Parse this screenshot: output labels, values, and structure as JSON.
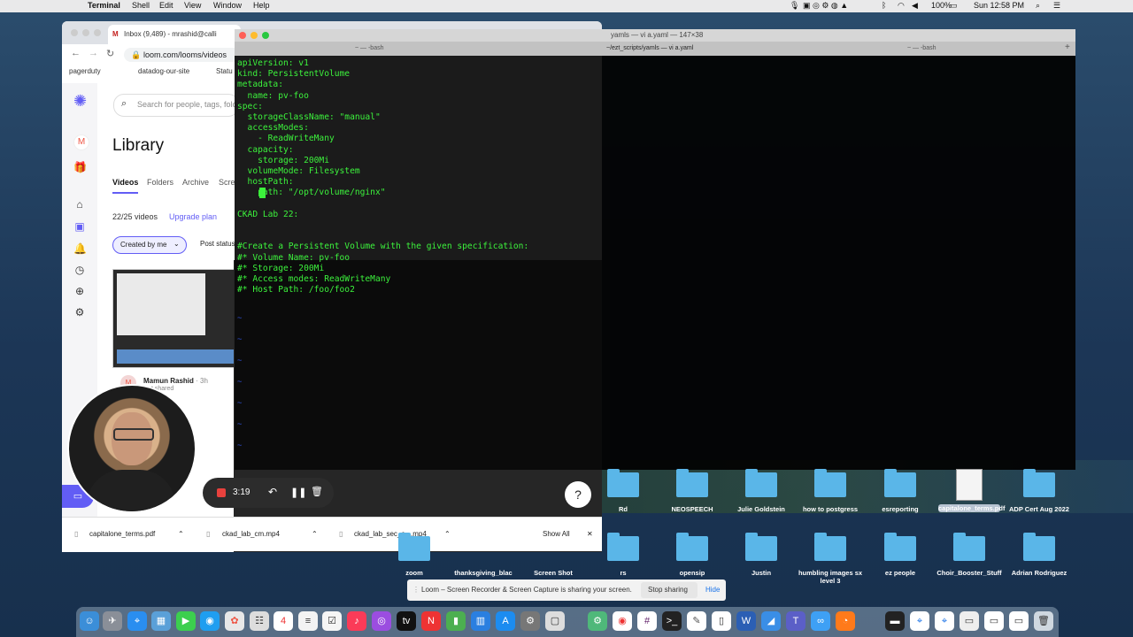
{
  "menubar": {
    "app": "Terminal",
    "items": [
      "Shell",
      "Edit",
      "View",
      "Window",
      "Help"
    ],
    "battery": "100%",
    "clock": "Sun 12:58 PM"
  },
  "browser": {
    "tab_title": "Inbox (9,489) - mrashid@calli",
    "url": "loom.com/looms/videos",
    "bookmarks": [
      "pagerduty",
      "datadog-our-site",
      "Statu"
    ]
  },
  "loom": {
    "search_placeholder": "Search for people, tags, fold",
    "page_title": "Library",
    "tabs": [
      "Videos",
      "Folders",
      "Archive",
      "Scre"
    ],
    "video_count": "22/25 videos",
    "upgrade_label": "Upgrade plan",
    "filter_created": "Created by me",
    "filter_status": "Post status",
    "author_name": "Mamun Rashid",
    "author_time": "· 3h",
    "author_shared": "Not shared",
    "sidebar_avatar": "M"
  },
  "recording": {
    "time": "3:19",
    "help": "?"
  },
  "downloads": {
    "files": [
      "capitalone_terms.pdf",
      "ckad_lab_cm.mp4",
      "ckad_lab_sec_c....mp4"
    ],
    "show_all": "Show All",
    "close": "✕"
  },
  "terminal": {
    "window_title": "yamls — vi a.yaml — 147×38",
    "tabs": [
      "~ — -bash",
      "~/ezt_scripts/yamls — vi a.yaml",
      "~ — -bash"
    ],
    "lines": [
      "apiVersion: v1",
      "kind: PersistentVolume",
      "metadata:",
      "  name: pv-foo",
      "spec:",
      "  storageClassName: \"manual\"",
      "  accessModes:",
      "    - ReadWriteMany",
      "  capacity:",
      "    storage: 200Mi",
      "  volumeMode: Filesystem",
      "  hostPath:",
      "    path: \"/opt/volume/nginx\"",
      "",
      "CKAD Lab 22:",
      "",
      "",
      "#Create a Persistent Volume with the given specification:",
      "#* Volume Name: pv-foo",
      "#* Storage: 200Mi",
      "#* Access modes: ReadWriteMany",
      "#* Host Path: /foo/foo2"
    ]
  },
  "desktop_icons": {
    "row1": [
      "Rd",
      "NEOSPEECH",
      "Julie Goldstein",
      "how to postgress",
      "esreporting",
      "capitalone_terms.pdf",
      "ADP Cert Aug 2022"
    ],
    "row2": [
      "zoom",
      "thanksgiving_blac",
      "Screen Shot",
      "rs",
      "opensip",
      "Justin",
      "humbling images sx level 3",
      "ez people",
      "Choir_Booster_Stuff",
      "Adrian Rodriguez"
    ]
  },
  "share_banner": {
    "message": "Loom – Screen Recorder & Screen Capture is sharing your screen.",
    "stop": "Stop sharing",
    "hide": "Hide"
  }
}
